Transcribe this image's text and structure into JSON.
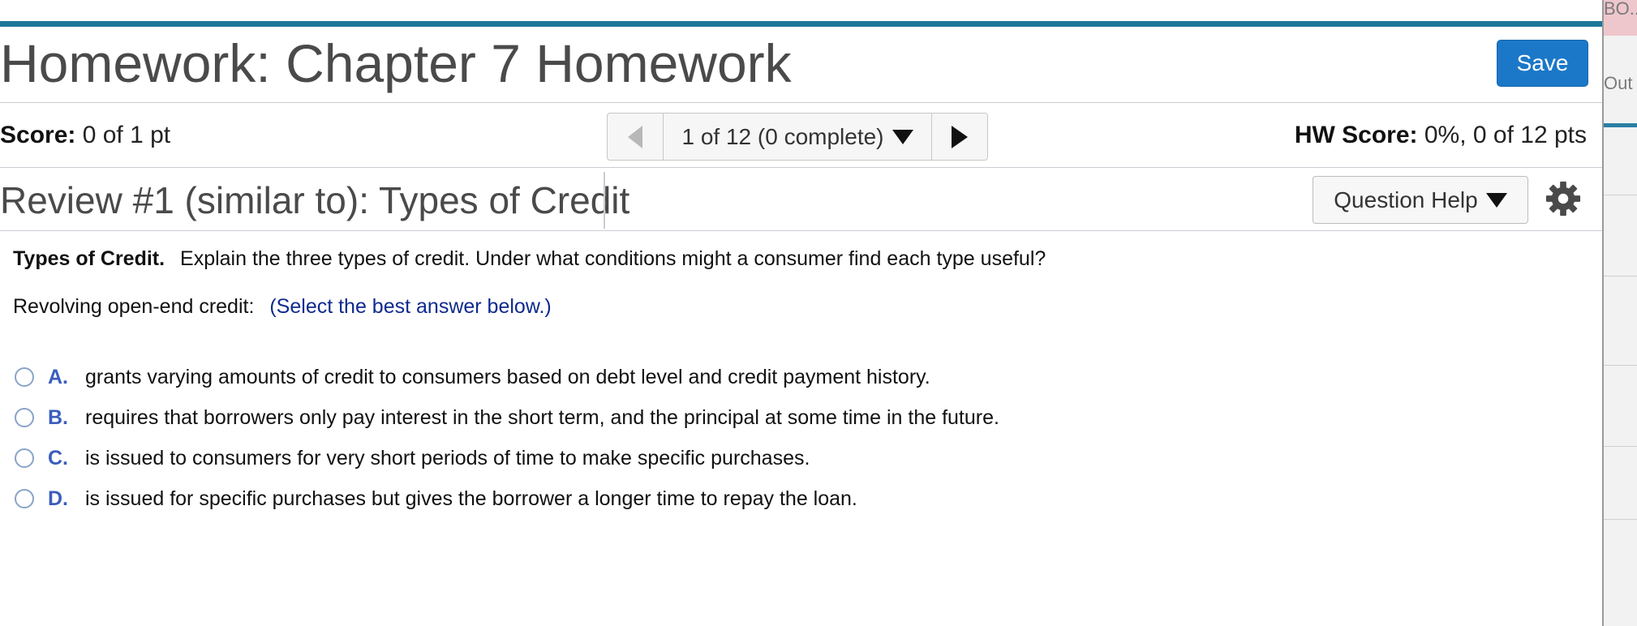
{
  "header": {
    "title": "Homework: Chapter 7 Homework",
    "save_label": "Save"
  },
  "scorebar": {
    "score_label": "Score:",
    "score_value": "0 of 1 pt",
    "nav_label": "1 of 12 (0 complete)",
    "hw_label": "HW Score:",
    "hw_value": "0%, 0 of 12 pts"
  },
  "question": {
    "title": "Review #1 (similar to): Types of Credit",
    "help_label": "Question Help",
    "prompt_bold": "Types of Credit.",
    "prompt_text": "Explain the three types of credit. Under what conditions might a consumer find each type useful?",
    "sub_label": "Revolving open-end credit:",
    "sub_hint": "(Select the best answer below.)",
    "options": [
      {
        "letter": "A.",
        "text": "grants varying amounts of credit to consumers based on debt level and credit payment history."
      },
      {
        "letter": "B.",
        "text": "requires that borrowers only pay interest in the short term, and the principal at some time in the future."
      },
      {
        "letter": "C.",
        "text": "is issued to consumers for very short periods of time to make specific purchases."
      },
      {
        "letter": "D.",
        "text": "is issued for specific purchases but gives the borrower a longer time to repay the loan."
      }
    ]
  },
  "side_panel": {
    "top_text": "BO...",
    "mid_text": "Out"
  },
  "colors": {
    "accent_bar": "#1e7898",
    "save_button": "#1b78c8",
    "option_letter": "#3a5dbd",
    "hint_text": "#0e2a8f"
  },
  "icons": [
    "chevron-left-icon",
    "caret-down-icon",
    "chevron-right-icon",
    "gear-icon",
    "radio-icon"
  ]
}
